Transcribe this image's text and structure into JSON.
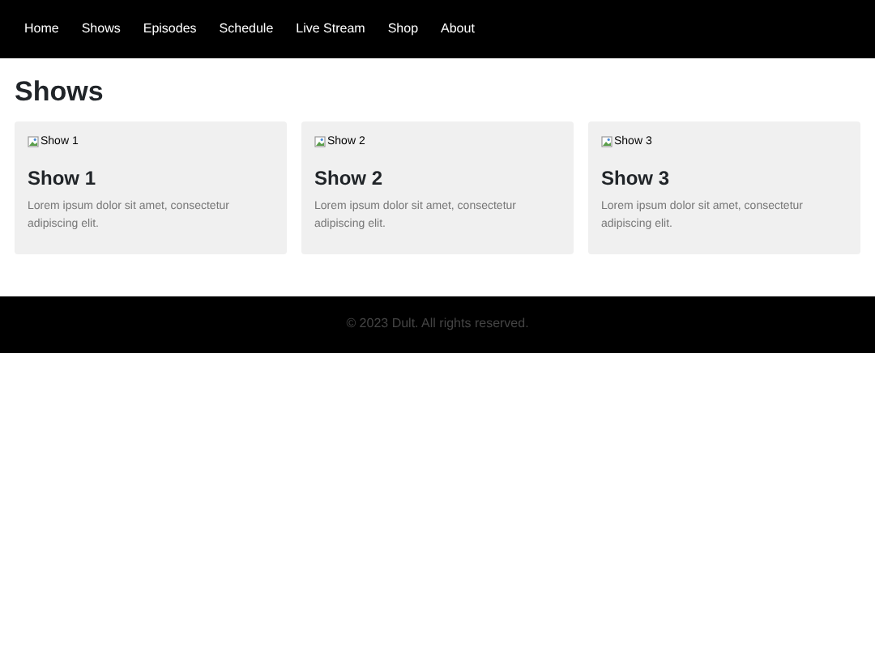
{
  "nav": {
    "items": [
      {
        "label": "Home"
      },
      {
        "label": "Shows"
      },
      {
        "label": "Episodes"
      },
      {
        "label": "Schedule"
      },
      {
        "label": "Live Stream"
      },
      {
        "label": "Shop"
      },
      {
        "label": "About"
      }
    ]
  },
  "heading": "Shows",
  "shows": [
    {
      "image_alt": "Show 1",
      "title": "Show 1",
      "description": "Lorem ipsum dolor sit amet, consectetur adipiscing elit."
    },
    {
      "image_alt": "Show 2",
      "title": "Show 2",
      "description": "Lorem ipsum dolor sit amet, consectetur adipiscing elit."
    },
    {
      "image_alt": "Show 3",
      "title": "Show 3",
      "description": "Lorem ipsum dolor sit amet, consectetur adipiscing elit."
    }
  ],
  "footer": "© 2023 Dult. All rights reserved."
}
